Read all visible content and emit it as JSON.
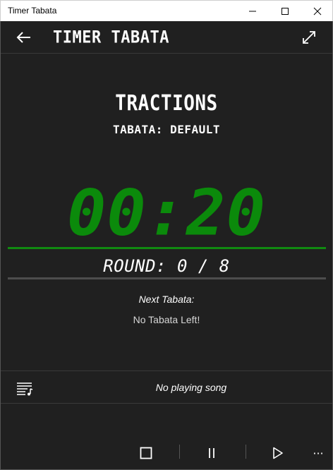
{
  "window": {
    "title": "Timer Tabata",
    "controls": [
      "minimize-icon",
      "maximize-icon",
      "close-icon"
    ]
  },
  "header": {
    "back_icon": "back-arrow-icon",
    "title": "TIMER TABATA",
    "expand_icon": "fullscreen-icon"
  },
  "workout": {
    "exercise": "TRACTIONS",
    "tabata_label": "TABATA:",
    "tabata_name": "DEFAULT",
    "timer": "00:20",
    "round_label": "ROUND:",
    "round_current": "0",
    "round_separator": "/",
    "round_total": "8",
    "time_progress": 1.0,
    "round_progress": 0.0
  },
  "next": {
    "label": "Next Tabata:",
    "value": "No Tabata Left!"
  },
  "music": {
    "playlist_icon": "playlist-icon",
    "song": "No playing song"
  },
  "commands": {
    "stop_icon": "stop-icon",
    "pause_icon": "pause-icon",
    "play_icon": "play-icon",
    "more": "···"
  },
  "colors": {
    "background": "#202020",
    "timer_green": "#0b8a0b",
    "accent_green": "#108a10"
  }
}
